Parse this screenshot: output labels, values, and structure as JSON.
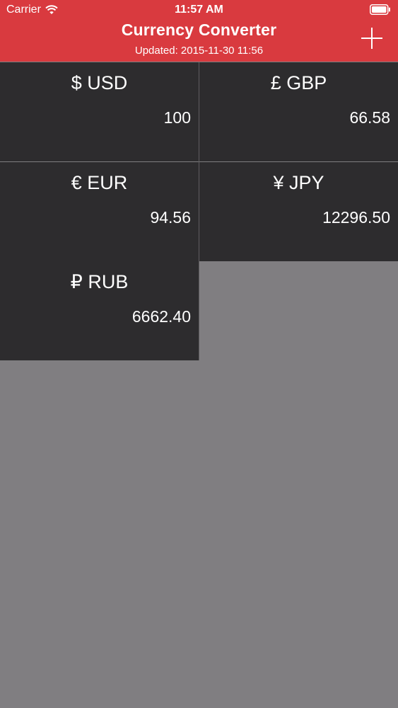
{
  "status_bar": {
    "carrier": "Carrier",
    "time": "11:57 AM",
    "wifi_icon": "wifi-icon",
    "battery_icon": "battery-icon"
  },
  "nav": {
    "title": "Currency Converter",
    "subtitle": "Updated: 2015-11-30 11:56",
    "add_icon": "plus-icon"
  },
  "colors": {
    "header_bg": "#d93a3f",
    "tile_bg": "#2d2c2e",
    "empty_bg": "#807e81",
    "text": "#ffffff"
  },
  "currencies": [
    {
      "label": "$ USD",
      "value": "100"
    },
    {
      "label": "£ GBP",
      "value": "66.58"
    },
    {
      "label": "€ EUR",
      "value": "94.56"
    },
    {
      "label": "¥ JPY",
      "value": "12296.50"
    },
    {
      "label": "₽ RUB",
      "value": "6662.40"
    }
  ]
}
